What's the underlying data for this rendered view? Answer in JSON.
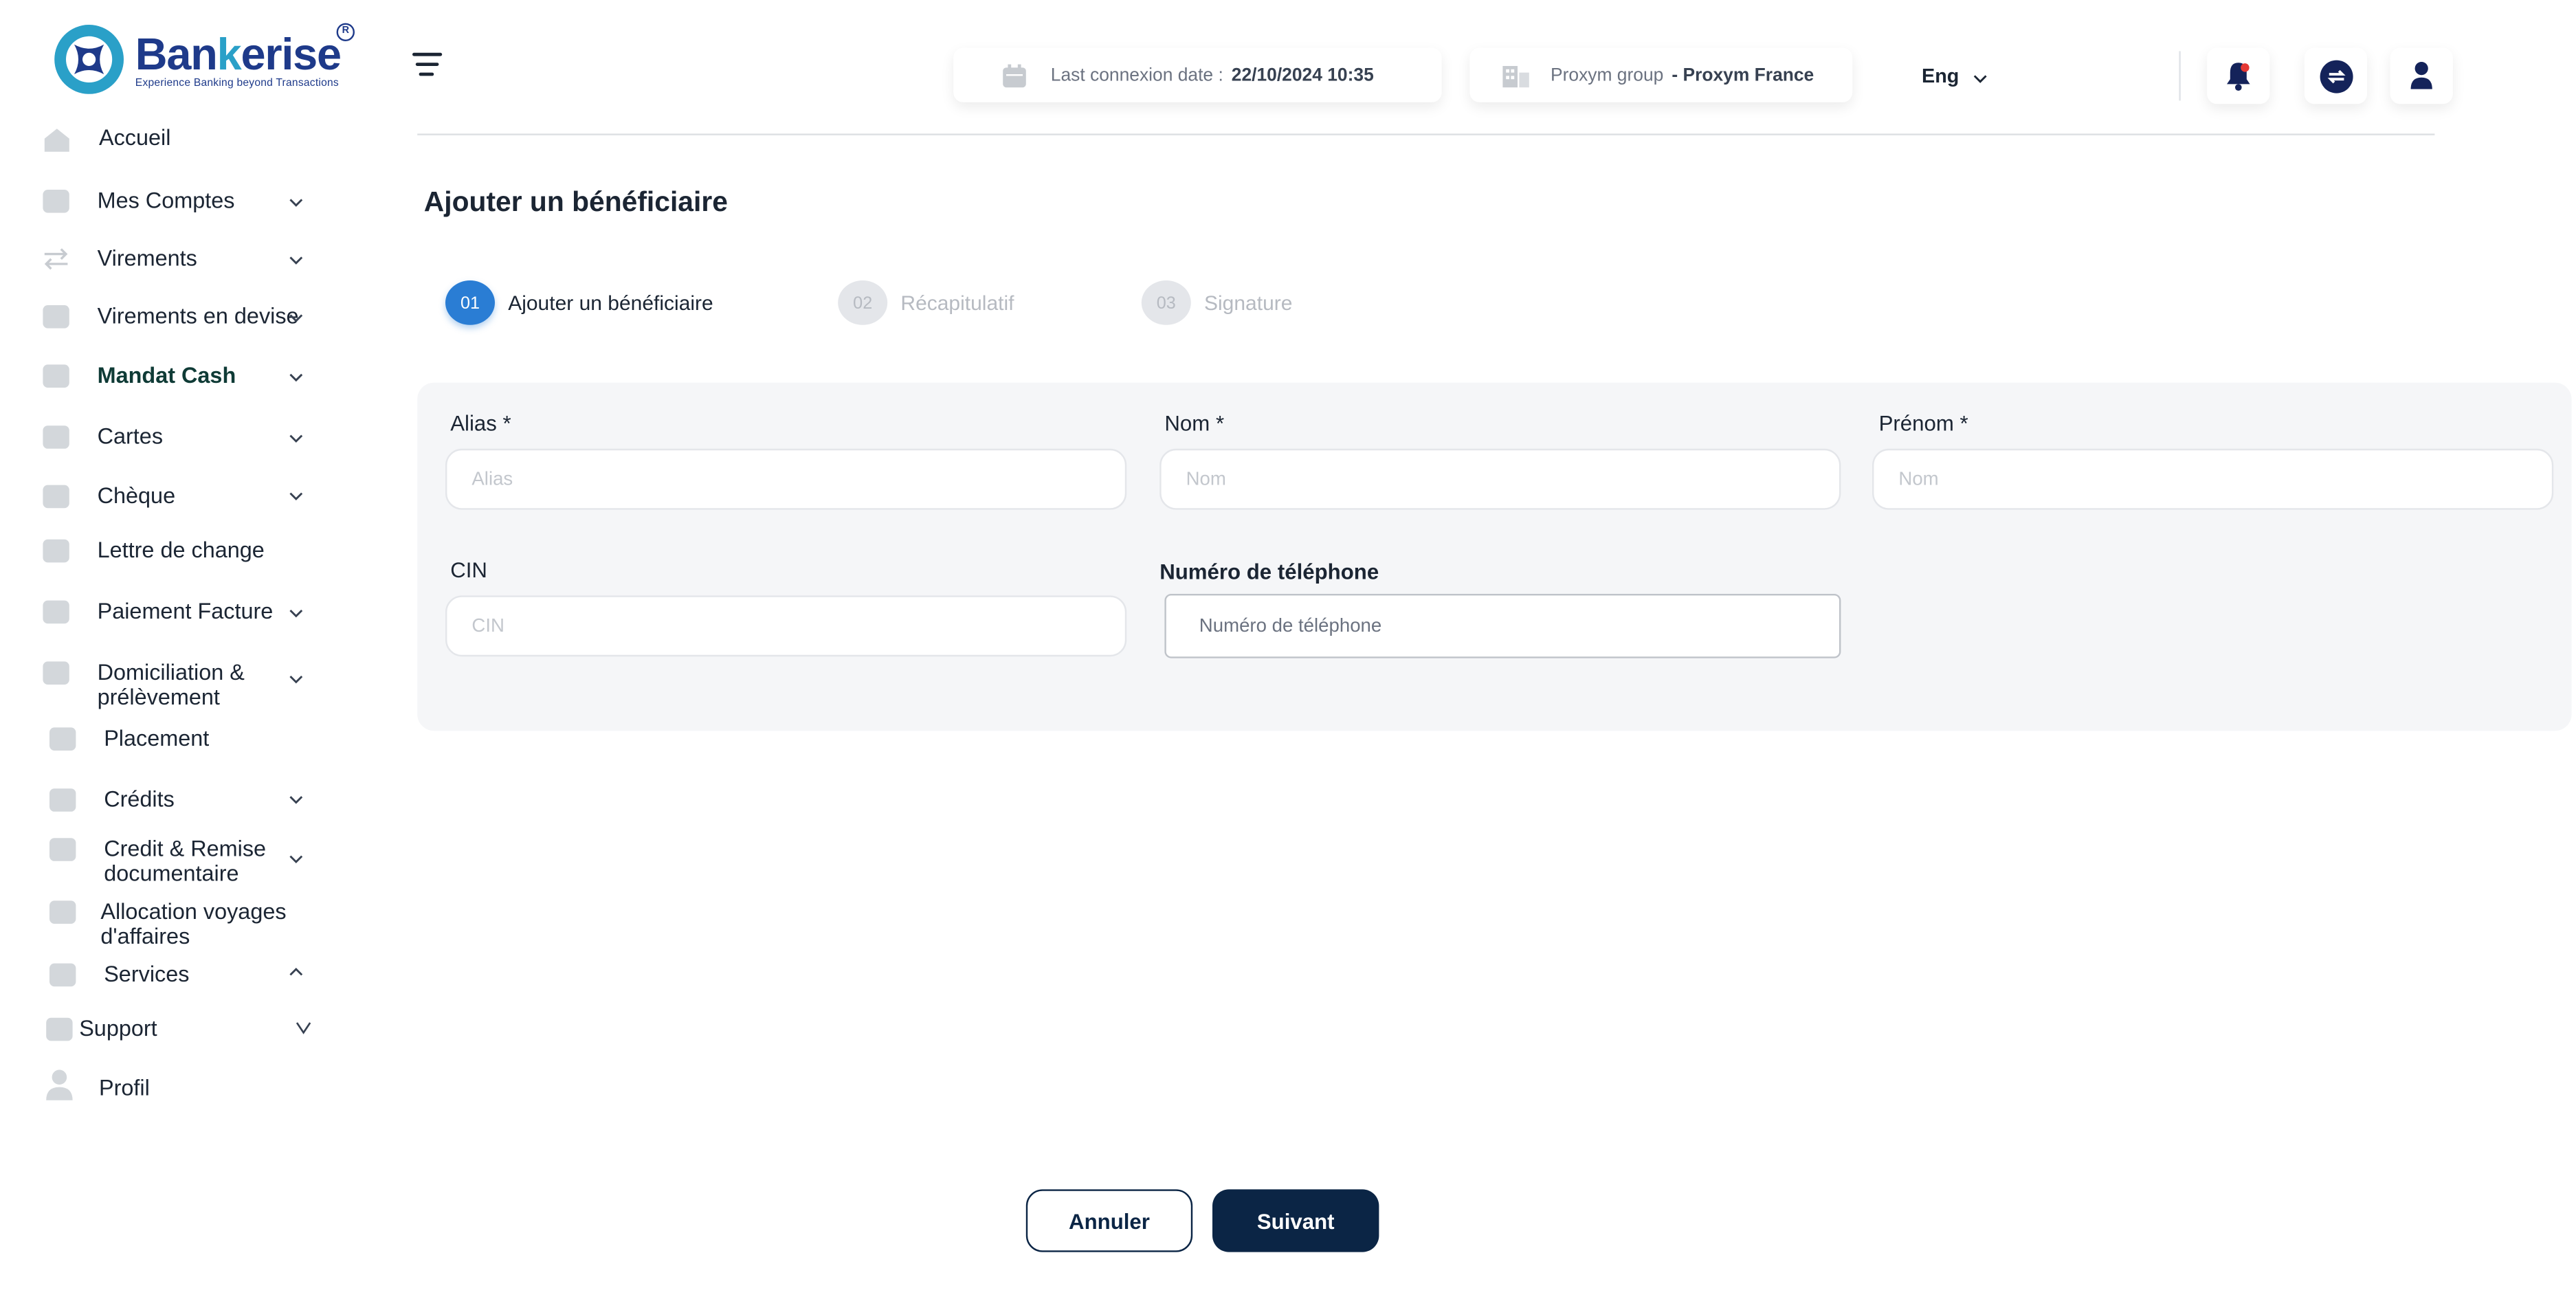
{
  "brand": {
    "name_part1": "Ban",
    "name_part2": "k",
    "name_part3": "erise",
    "tagline": "Experience Banking beyond Transactions",
    "registered": "R",
    "colors": {
      "primary": "#1e3a8a",
      "accent": "#2aa0c8"
    }
  },
  "sidebar": {
    "items": [
      {
        "label": "Accueil",
        "icon": "home-icon",
        "has_chevron": false
      },
      {
        "label": "Mes Comptes",
        "icon": "folder-icon",
        "has_chevron": true
      },
      {
        "label": "Virements",
        "icon": "transfer-arrows-icon",
        "has_chevron": true
      },
      {
        "label": "Virements en devise",
        "icon": "currency-icon",
        "has_chevron": true
      },
      {
        "label": "Mandat Cash",
        "icon": "mail-icon",
        "has_chevron": true,
        "active": true
      },
      {
        "label": "Cartes",
        "icon": "card-icon",
        "has_chevron": true
      },
      {
        "label": "Chèque",
        "icon": "cheque-icon",
        "has_chevron": true
      },
      {
        "label": "Lettre de change",
        "icon": "mail-icon",
        "has_chevron": false
      },
      {
        "label": "Paiement Facture",
        "icon": "invoice-icon",
        "has_chevron": true
      },
      {
        "label": "Domiciliation & prélèvement",
        "icon": "mail-icon",
        "has_chevron": true
      },
      {
        "label": "Placement",
        "icon": "chart-icon",
        "has_chevron": false
      },
      {
        "label": "Crédits",
        "icon": "mail-icon",
        "has_chevron": true
      },
      {
        "label": "Credit & Remise documentaire",
        "icon": "mail-icon",
        "has_chevron": true
      },
      {
        "label": "Allocation  voyages d'affaires",
        "icon": "mail-icon",
        "has_chevron": false
      },
      {
        "label": "Services",
        "icon": "mail-icon",
        "has_chevron": true,
        "expanded": true
      },
      {
        "label": "Support",
        "icon": "support-icon",
        "has_chevron": true
      },
      {
        "label": "Profil",
        "icon": "user-icon",
        "has_chevron": false
      }
    ]
  },
  "header": {
    "last_connexion_label": "Last connexion date :",
    "last_connexion_value": "22/10/2024 10:35",
    "group_label": "Proxym group",
    "group_value": "- Proxym France",
    "language": "Eng"
  },
  "page": {
    "title": "Ajouter un bénéficiaire"
  },
  "stepper": [
    {
      "num": "01",
      "label": "Ajouter un bénéficiaire",
      "state": "active"
    },
    {
      "num": "02",
      "label": "Récapitulatif",
      "state": "inactive"
    },
    {
      "num": "03",
      "label": "Signature",
      "state": "inactive"
    }
  ],
  "form": {
    "alias": {
      "label": "Alias *",
      "placeholder": "Alias",
      "value": ""
    },
    "nom": {
      "label": "Nom *",
      "placeholder": "Nom",
      "value": ""
    },
    "prenom": {
      "label": "Prénom *",
      "placeholder": "Nom",
      "value": ""
    },
    "cin": {
      "label": "CIN",
      "placeholder": "CIN",
      "value": ""
    },
    "phone": {
      "label": "Numéro de téléphone",
      "placeholder": "Numéro de téléphone",
      "value": ""
    }
  },
  "actions": {
    "cancel_label": "Annuler",
    "next_label": "Suivant"
  },
  "colors": {
    "primary_dark": "#0b2545",
    "step_active": "#2a7dd4",
    "notification_dot": "#e53935"
  }
}
